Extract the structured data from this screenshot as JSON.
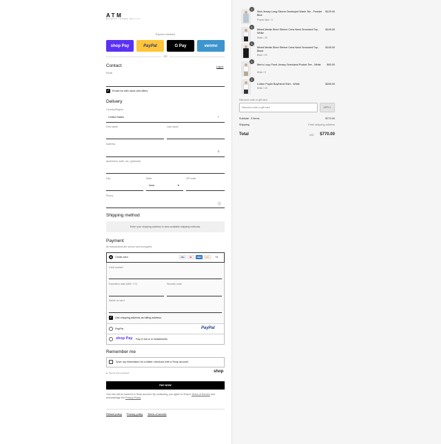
{
  "brand": {
    "name": "ATM",
    "tagline": "ANTHONY THOMAS MELILLO"
  },
  "express": {
    "label": "Express checkout",
    "or": "OR",
    "buttons": [
      {
        "label": "shop Pay",
        "color": "#5a31f4"
      },
      {
        "label": "PayPal",
        "color": "#ffc439"
      },
      {
        "label": "G Pay",
        "color": "#000000"
      },
      {
        "label": "venmo",
        "color": "#3d95ce"
      }
    ]
  },
  "contact": {
    "heading": "Contact",
    "login": "Log in",
    "email_placeholder": "Email",
    "newsletter_label": "Email me with news and offers"
  },
  "delivery": {
    "heading": "Delivery",
    "country_label": "Country/Region",
    "country_value": "United States",
    "first_name": "First name",
    "last_name": "Last name",
    "address": "Address",
    "apartment": "Apartment, suite, etc. (optional)",
    "city": "City",
    "state_label": "State",
    "state_value": "Iowa",
    "zip": "ZIP code",
    "phone": "Phone"
  },
  "shipping": {
    "heading": "Shipping method",
    "message": "Enter your shipping address to view available shipping methods."
  },
  "payment": {
    "heading": "Payment",
    "subtitle": "All transactions are secure and encrypted.",
    "credit_card": "Credit card",
    "card_logos": [
      "VISA",
      "MC",
      "AMEX",
      "DISC"
    ],
    "more_cards": "+4",
    "card_number": "Card number",
    "expiration": "Expiration date (MM / YY)",
    "security": "Security code",
    "name_on_card": "Name on card",
    "billing_same": "Use shipping address as billing address",
    "paypal": "PayPal",
    "paypal_logo": "PayPal",
    "shop_pay_logo": "shop Pay",
    "shop_pay_text": "Pay in full or in installments"
  },
  "remember": {
    "heading": "Remember me",
    "save_info": "Save my information for a faster checkout with a Shop account",
    "secure": "Secure and encrypted",
    "shop_logo": "shop"
  },
  "pay_now": "PAY NOW",
  "legal": {
    "text_before": "Your info will be saved to a Shop account. By continuing, you agree to Shop's",
    "terms": "Terms of Service",
    "and": "and acknowledge the",
    "privacy": "Privacy Policy"
  },
  "footer_links": [
    "Refund policy",
    "Privacy policy",
    "Terms of service"
  ],
  "cart": {
    "items": [
      {
        "qty": "1",
        "name": "Slub Jersey Long Sleeve Destroyed Wash Tee - Powder Blue",
        "variant": "Powder Blue / S",
        "price": "$125.00"
      },
      {
        "qty": "1",
        "name": "Mixed Media Short Sleeve Crew Neck Smocked Top - White",
        "variant": "White / XS",
        "price": "$145.00"
      },
      {
        "qty": "1",
        "name": "Mixed Media Short Sleeve Crew Neck Smocked Top - Black",
        "variant": "Black / XS",
        "price": "$145.00"
      },
      {
        "qty": "1",
        "name": "Men's Loop Front Jersey Oversized Pocket Tee - White",
        "variant": "White / S",
        "price": "$90.00"
      },
      {
        "qty": "1",
        "name": "Cotton Poplin Boyfriend Shirt - White",
        "variant": "White / XS",
        "price": "$265.00"
      }
    ],
    "discount_label": "Discount code or gift card",
    "discount_placeholder": "Discount code or gift card",
    "apply": "APPLY",
    "subtotal_label": "Subtotal · 5 items",
    "subtotal_value": "$770.00",
    "shipping_label": "Shipping",
    "shipping_value": "Enter shipping address",
    "total_label": "Total",
    "currency": "USD",
    "total_value": "$770.00"
  }
}
